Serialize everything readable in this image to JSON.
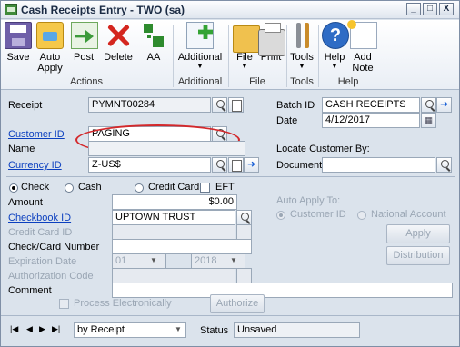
{
  "window": {
    "title": "Cash Receipts Entry  -  TWO (sa)",
    "controls": [
      "_",
      "□",
      "X"
    ]
  },
  "ribbon": {
    "buttons": {
      "save": "Save",
      "auto_apply_line1": "Auto",
      "auto_apply_line2": "Apply",
      "post": "Post",
      "delete": "Delete",
      "aa": "AA",
      "additional": "Additional",
      "file": "File",
      "print": "Print",
      "tools": "Tools",
      "help": "Help",
      "add_note_line1": "Add",
      "add_note_line2": "Note"
    },
    "groups": {
      "actions": "Actions",
      "additional": "Additional",
      "file": "File",
      "tools": "Tools",
      "help": "Help"
    },
    "help_glyph": "?"
  },
  "form": {
    "receipt_label": "Receipt",
    "receipt_value": "PYMNT00284",
    "batch_id_label": "Batch ID",
    "batch_id_value": "CASH RECEIPTS",
    "date_label": "Date",
    "date_value": "4/12/2017",
    "customer_id_label": "Customer ID",
    "customer_id_value": "PAGING",
    "name_label": "Name",
    "name_value": "",
    "locate_customer_by_label": "Locate Customer By:",
    "currency_id_label": "Currency ID",
    "currency_id_value": "Z-US$",
    "document_label": "Document",
    "document_value": ""
  },
  "payment": {
    "type_check": "Check",
    "type_cash": "Cash",
    "type_credit_card": "Credit Card",
    "eft_label": "EFT",
    "selected_type": "Check",
    "amount_label": "Amount",
    "amount_value": "$0.00",
    "checkbook_id_label": "Checkbook ID",
    "checkbook_id_value": "UPTOWN TRUST",
    "credit_card_id_label": "Credit Card ID",
    "check_card_number_label": "Check/Card Number",
    "expiration_date_label": "Expiration Date",
    "expiration_month": "01",
    "expiration_year": "2018",
    "authorization_code_label": "Authorization Code",
    "comment_label": "Comment",
    "comment_value": "",
    "process_electronically_label": "Process Electronically",
    "authorize_button": "Authorize"
  },
  "auto_apply": {
    "label": "Auto Apply To:",
    "option_customer_id": "Customer ID",
    "option_national_account": "National Account",
    "apply_button": "Apply",
    "distribution_button": "Distribution"
  },
  "status_bar": {
    "nav_first": "|◀",
    "nav_prev": "◀",
    "nav_next": "▶",
    "nav_last": "▶|",
    "sort_value": "by Receipt",
    "status_label": "Status",
    "status_value": "Unsaved"
  }
}
